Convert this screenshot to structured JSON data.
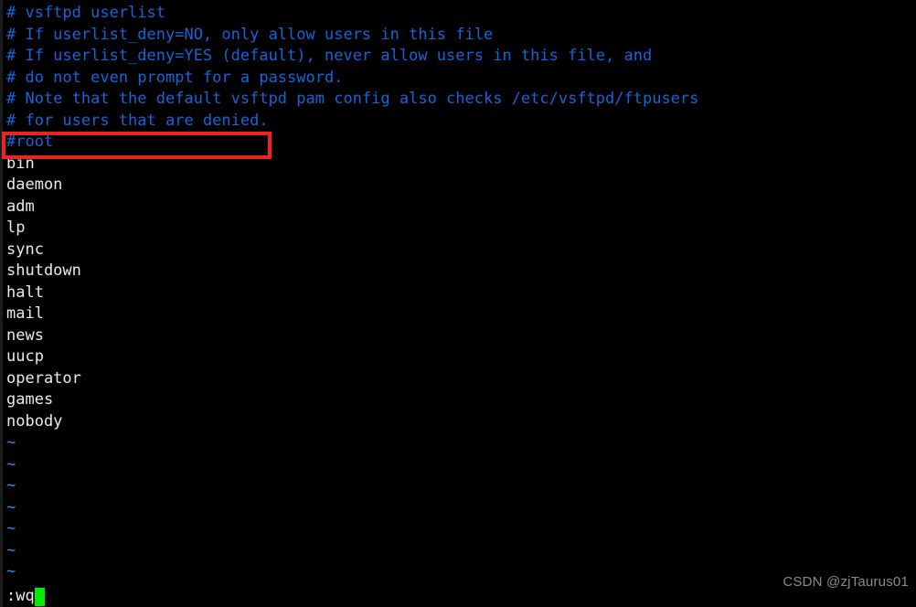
{
  "terminal": {
    "background_color": "#000000",
    "comment_color": "#1565d8",
    "text_color": "#e9e9e9",
    "tilde_color": "#2b8bee",
    "cursor_color": "#00ee00",
    "annotation_color": "#ee2222"
  },
  "editor": {
    "lines": [
      {
        "kind": "comment",
        "text": "# vsftpd userlist"
      },
      {
        "kind": "comment",
        "text": "# If userlist_deny=NO, only allow users in this file"
      },
      {
        "kind": "comment",
        "text": "# If userlist_deny=YES (default), never allow users in this file, and"
      },
      {
        "kind": "comment",
        "text": "# do not even prompt for a password."
      },
      {
        "kind": "comment",
        "text": "# Note that the default vsftpd pam config also checks /etc/vsftpd/ftpusers"
      },
      {
        "kind": "comment",
        "text": "# for users that are denied."
      },
      {
        "kind": "comment",
        "text": "#root"
      },
      {
        "kind": "entry",
        "text": "bin"
      },
      {
        "kind": "entry",
        "text": "daemon"
      },
      {
        "kind": "entry",
        "text": "adm"
      },
      {
        "kind": "entry",
        "text": "lp"
      },
      {
        "kind": "entry",
        "text": "sync"
      },
      {
        "kind": "entry",
        "text": "shutdown"
      },
      {
        "kind": "entry",
        "text": "halt"
      },
      {
        "kind": "entry",
        "text": "mail"
      },
      {
        "kind": "entry",
        "text": "news"
      },
      {
        "kind": "entry",
        "text": "uucp"
      },
      {
        "kind": "entry",
        "text": "operator"
      },
      {
        "kind": "entry",
        "text": "games"
      },
      {
        "kind": "entry",
        "text": "nobody"
      },
      {
        "kind": "tilde",
        "text": "~"
      },
      {
        "kind": "tilde",
        "text": "~"
      },
      {
        "kind": "tilde",
        "text": "~"
      },
      {
        "kind": "tilde",
        "text": "~"
      },
      {
        "kind": "tilde",
        "text": "~"
      },
      {
        "kind": "tilde",
        "text": "~"
      },
      {
        "kind": "tilde",
        "text": "~"
      }
    ]
  },
  "status": {
    "command": ":wq"
  },
  "annotation": {
    "target_line": "#root"
  },
  "watermark": {
    "text": "CSDN @zjTaurus01"
  }
}
